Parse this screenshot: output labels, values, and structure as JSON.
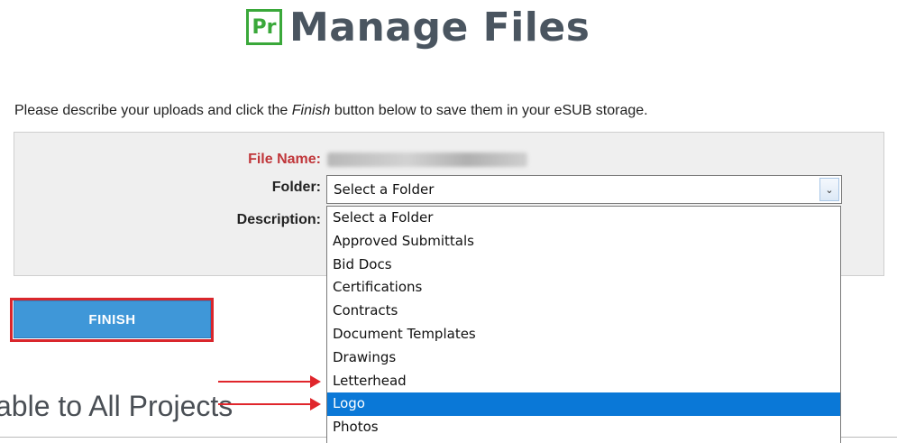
{
  "header": {
    "logo_text": "Pr",
    "title": "Manage Files"
  },
  "instructions": {
    "before": "Please describe your uploads and click the ",
    "emphasis": "Finish",
    "after": " button below to save them in your eSUB storage."
  },
  "form": {
    "file_name_label": "File Name:",
    "folder_label": "Folder:",
    "description_label": "Description:",
    "folder_selected": "Select a Folder"
  },
  "folder_options": [
    {
      "label": "Select a Folder",
      "selected": false
    },
    {
      "label": "Approved Submittals",
      "selected": false
    },
    {
      "label": "Bid Docs",
      "selected": false
    },
    {
      "label": "Certifications",
      "selected": false
    },
    {
      "label": "Contracts",
      "selected": false
    },
    {
      "label": "Document Templates",
      "selected": false
    },
    {
      "label": "Drawings",
      "selected": false
    },
    {
      "label": "Letterhead",
      "selected": false
    },
    {
      "label": "Logo",
      "selected": true
    },
    {
      "label": "Photos",
      "selected": false
    }
  ],
  "finish_button": {
    "label": "FINISH"
  },
  "section": {
    "heading": "able to All Projects"
  },
  "colors": {
    "accent": "#3f97d8",
    "highlight": "#d9262c",
    "selection": "#0a78d7",
    "logo_green": "#3aa83a",
    "error_label": "#c0363a"
  }
}
